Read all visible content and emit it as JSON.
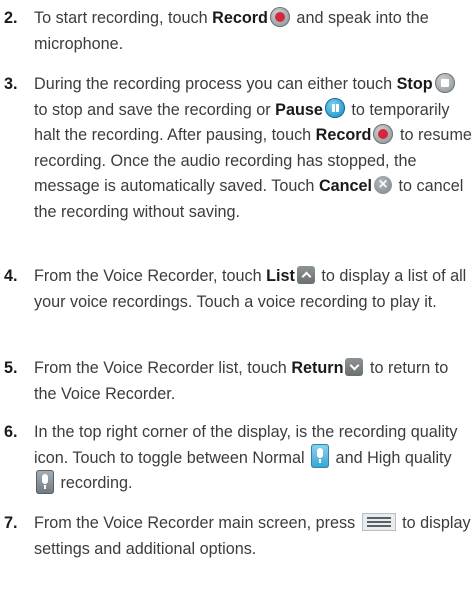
{
  "steps": [
    {
      "number": "2.",
      "segments": [
        {
          "t": "To start recording, touch "
        },
        {
          "b": "Record"
        },
        {
          "icon": "record-icon"
        },
        {
          "t": " and speak into the microphone."
        }
      ]
    },
    {
      "number": "3.",
      "segments": [
        {
          "t": "During the recording process you can either touch "
        },
        {
          "b": "Stop"
        },
        {
          "icon": "stop-icon"
        },
        {
          "t": " to stop and save the recording or "
        },
        {
          "b": "Pause"
        },
        {
          "icon": "pause-icon"
        },
        {
          "t": " to temporarily halt the recording. After pausing, touch "
        },
        {
          "b": "Record"
        },
        {
          "icon": "record-icon"
        },
        {
          "t": " to resume recording. Once the audio recording has stopped, the message is automatically saved. Touch "
        },
        {
          "b": "Cancel"
        },
        {
          "icon": "cancel-icon"
        },
        {
          "t": " to cancel the recording without saving."
        }
      ]
    },
    {
      "number": "4.",
      "segments": [
        {
          "t": "From the Voice Recorder, touch "
        },
        {
          "b": "List"
        },
        {
          "icon": "chevron-up-icon"
        },
        {
          "t": " to display a list of all your voice recordings. Touch a voice recording to play it."
        }
      ]
    },
    {
      "number": "5.",
      "segments": [
        {
          "t": "From the Voice Recorder list, touch "
        },
        {
          "b": "Return"
        },
        {
          "icon": "chevron-down-icon"
        },
        {
          "t": " to return to the Voice Recorder."
        }
      ]
    },
    {
      "number": "6.",
      "segments": [
        {
          "t": "In the top right corner of the display, is the recording quality icon. Touch to toggle between Normal "
        },
        {
          "icon": "normal-quality-mic-icon"
        },
        {
          "t": " and High quality "
        },
        {
          "icon": "high-quality-mic-icon"
        },
        {
          "t": " recording."
        }
      ]
    },
    {
      "number": "7.",
      "segments": [
        {
          "t": "From the Voice Recorder main screen, press "
        },
        {
          "icon": "menu-key-icon"
        },
        {
          "t": " to display settings and additional options."
        }
      ]
    }
  ]
}
